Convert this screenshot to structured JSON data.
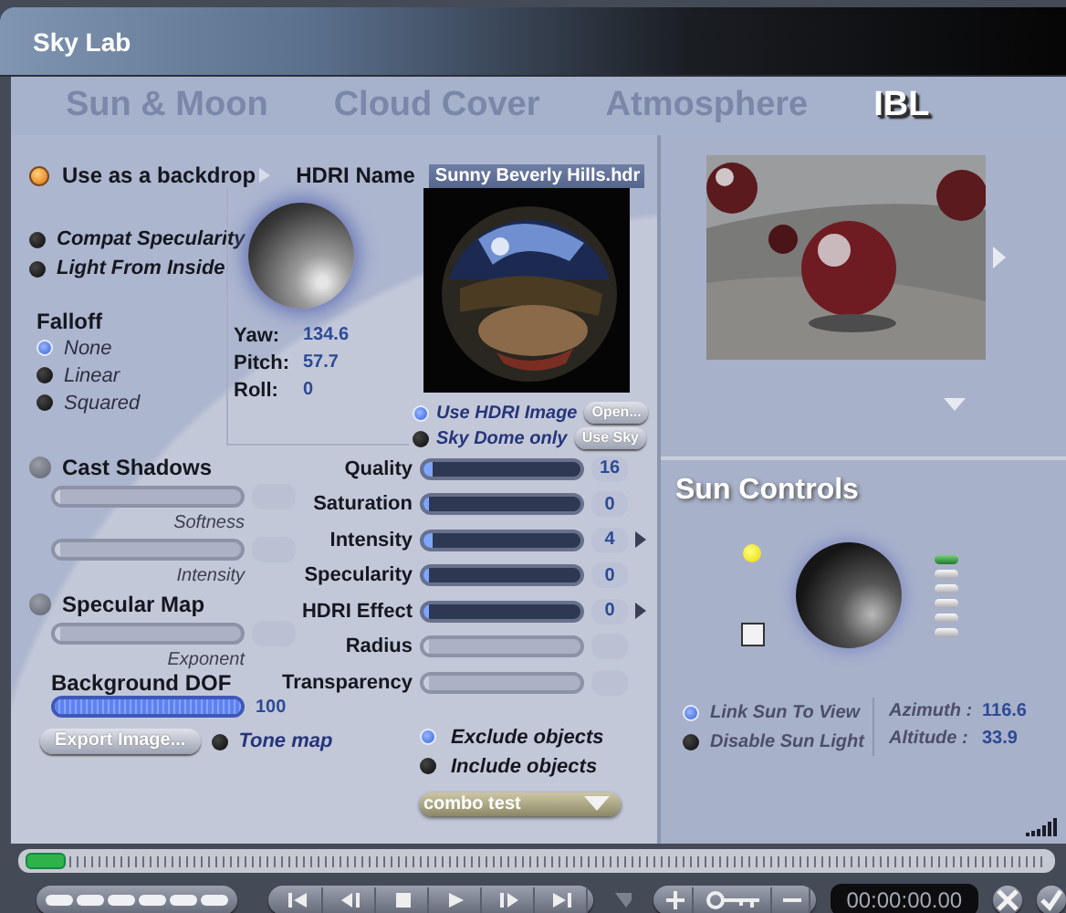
{
  "window": {
    "title": "Sky Lab"
  },
  "tabs": [
    {
      "label": "Sun & Moon",
      "selected": false
    },
    {
      "label": "Cloud Cover",
      "selected": false
    },
    {
      "label": "Atmosphere",
      "selected": false
    },
    {
      "label": "IBL",
      "selected": true
    }
  ],
  "backdrop": {
    "label": "Use as a backdrop",
    "on": true
  },
  "hdri_name": {
    "label": "HDRI Name",
    "value": "Sunny Beverly Hills.hdr"
  },
  "options": [
    {
      "label": "Compat Specularity",
      "checked": false
    },
    {
      "label": "Light From Inside",
      "checked": false
    }
  ],
  "falloff": {
    "label": "Falloff",
    "options": [
      {
        "label": "None",
        "selected": true
      },
      {
        "label": "Linear",
        "selected": false
      },
      {
        "label": "Squared",
        "selected": false
      }
    ]
  },
  "rotation": [
    {
      "label": "Yaw:",
      "value": "134.6"
    },
    {
      "label": "Pitch:",
      "value": "57.7"
    },
    {
      "label": "Roll:",
      "value": "0"
    }
  ],
  "hdri_source": [
    {
      "label": "Use HDRI Image",
      "selected": true,
      "button": "Open..."
    },
    {
      "label": "Sky Dome only",
      "selected": false,
      "button": "Use Sky"
    }
  ],
  "toggles": [
    {
      "label": "Cast Shadows",
      "on": false,
      "sliders": [
        {
          "caption": "Softness",
          "level": 0
        },
        {
          "caption": "Intensity",
          "level": 0
        }
      ]
    },
    {
      "label": "Specular Map",
      "on": false,
      "sliders": [
        {
          "caption": "Exponent",
          "level": 0
        }
      ]
    }
  ],
  "background_dof": {
    "label": "Background DOF",
    "level": 1,
    "value": "100"
  },
  "export_button": "Export Image...",
  "tone_map": {
    "label": "Tone map",
    "on": false
  },
  "parameters": [
    {
      "label": "Quality",
      "enabled": true,
      "level": 0.02,
      "value": "16",
      "arrow": false
    },
    {
      "label": "Saturation",
      "enabled": true,
      "level": 0,
      "value": "0",
      "arrow": false
    },
    {
      "label": "Intensity",
      "enabled": true,
      "level": 0.02,
      "value": "4",
      "arrow": true
    },
    {
      "label": "Specularity",
      "enabled": true,
      "level": 0,
      "value": "0",
      "arrow": false
    },
    {
      "label": "HDRI Effect",
      "enabled": true,
      "level": 0,
      "value": "0",
      "arrow": true
    },
    {
      "label": "Radius",
      "enabled": false,
      "level": 0,
      "arrow": false
    },
    {
      "label": "Transparency",
      "enabled": false,
      "level": 0,
      "arrow": false
    }
  ],
  "object_mode": [
    {
      "label": "Exclude objects",
      "selected": true
    },
    {
      "label": "Include objects",
      "selected": false
    }
  ],
  "combo": {
    "value": "combo test"
  },
  "sun_controls": {
    "title": "Sun Controls",
    "options": [
      {
        "label": "Link Sun To View",
        "selected": true
      },
      {
        "label": "Disable Sun Light",
        "selected": false
      }
    ],
    "readings": [
      {
        "label": "Azimuth :",
        "value": "116.6"
      },
      {
        "label": "Altitude :",
        "value": "33.9"
      }
    ]
  },
  "time_display": "00:00:00.00"
}
